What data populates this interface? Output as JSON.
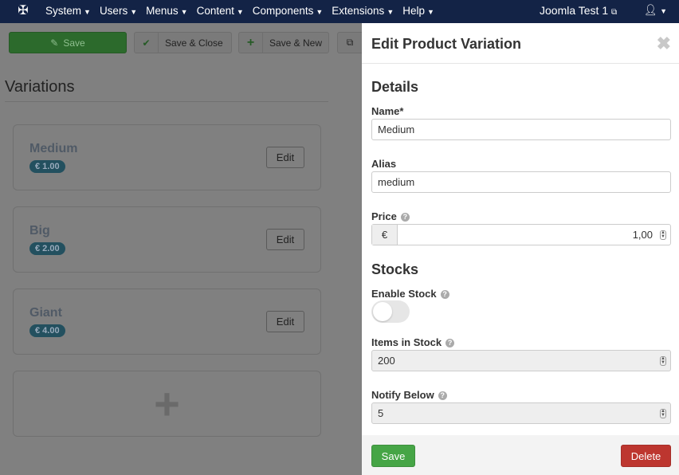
{
  "navbar": {
    "logo": "joomla-logo",
    "menu": [
      "System",
      "Users",
      "Menus",
      "Content",
      "Components",
      "Extensions",
      "Help"
    ],
    "site_name": "Joomla Test 1"
  },
  "toolbar": {
    "save": "Save",
    "save_close": "Save & Close",
    "save_new": "Save & New"
  },
  "page": {
    "title": "Variations"
  },
  "variations": [
    {
      "name": "Medium",
      "price": "€ 1.00",
      "edit": "Edit"
    },
    {
      "name": "Big",
      "price": "€ 2.00",
      "edit": "Edit"
    },
    {
      "name": "Giant",
      "price": "€ 4.00",
      "edit": "Edit"
    }
  ],
  "add_symbol": "+",
  "panel": {
    "title": "Edit Product Variation",
    "details_heading": "Details",
    "name_label": "Name*",
    "name_value": "Medium",
    "alias_label": "Alias",
    "alias_value": "medium",
    "price_label": "Price",
    "currency": "€",
    "price_value": "1,00",
    "stocks_heading": "Stocks",
    "enable_stock_label": "Enable Stock",
    "enable_stock": false,
    "items_label": "Items in Stock",
    "items_value": "200",
    "notify_label": "Notify Below",
    "notify_value": "5",
    "save": "Save",
    "delete": "Delete"
  },
  "colors": {
    "navbar": "#132346",
    "save": "#46a546",
    "delete": "#bd362f",
    "badge": "#23505f"
  }
}
